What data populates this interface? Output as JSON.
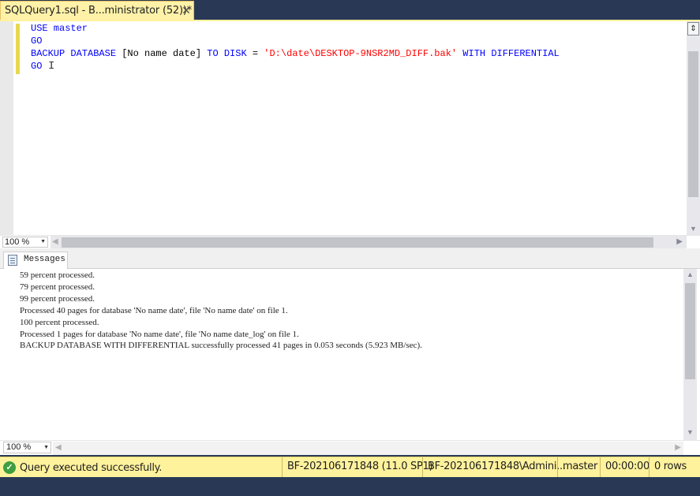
{
  "tab": {
    "title": "SQLQuery1.sql - B...ministrator (52))*",
    "close_icon": "close-icon"
  },
  "editor": {
    "lines": [
      [
        {
          "t": "USE master",
          "c": "kw"
        }
      ],
      [
        {
          "t": "GO",
          "c": "kw"
        }
      ],
      [
        {
          "t": "BACKUP DATABASE ",
          "c": "kw"
        },
        {
          "t": "[No name date]",
          "c": "ident"
        },
        {
          "t": " TO DISK ",
          "c": "kw"
        },
        {
          "t": "= ",
          "c": "ident"
        },
        {
          "t": "'D:\\date\\DESKTOP-9NSR2MD_DIFF.bak'",
          "c": "str"
        },
        {
          "t": " WITH DIFFERENTIAL",
          "c": "kw"
        }
      ],
      [
        {
          "t": "GO",
          "c": "kw"
        }
      ]
    ],
    "zoom": "100 %"
  },
  "results": {
    "tab_label": "Messages",
    "messages": [
      "59 percent processed.",
      "79 percent processed.",
      "99 percent processed.",
      "Processed 40 pages for database 'No name date', file 'No name date' on file 1.",
      "100 percent processed.",
      "Processed 1 pages for database 'No name date', file 'No name date_log' on file 1.",
      "BACKUP DATABASE WITH DIFFERENTIAL successfully processed 41 pages in 0.053 seconds (5.923 MB/sec)."
    ],
    "zoom": "100 %"
  },
  "status": {
    "message": "Query executed successfully.",
    "server": "BF-202106171848 (11.0 SP1)",
    "user": "BF-202106171848\\Admini...",
    "database": "master",
    "elapsed": "00:00:00",
    "rows": "0 rows"
  },
  "colors": {
    "keyword": "#0000ff",
    "string": "#ff0000",
    "status_bar": "#fff29d",
    "frame": "#293955"
  }
}
